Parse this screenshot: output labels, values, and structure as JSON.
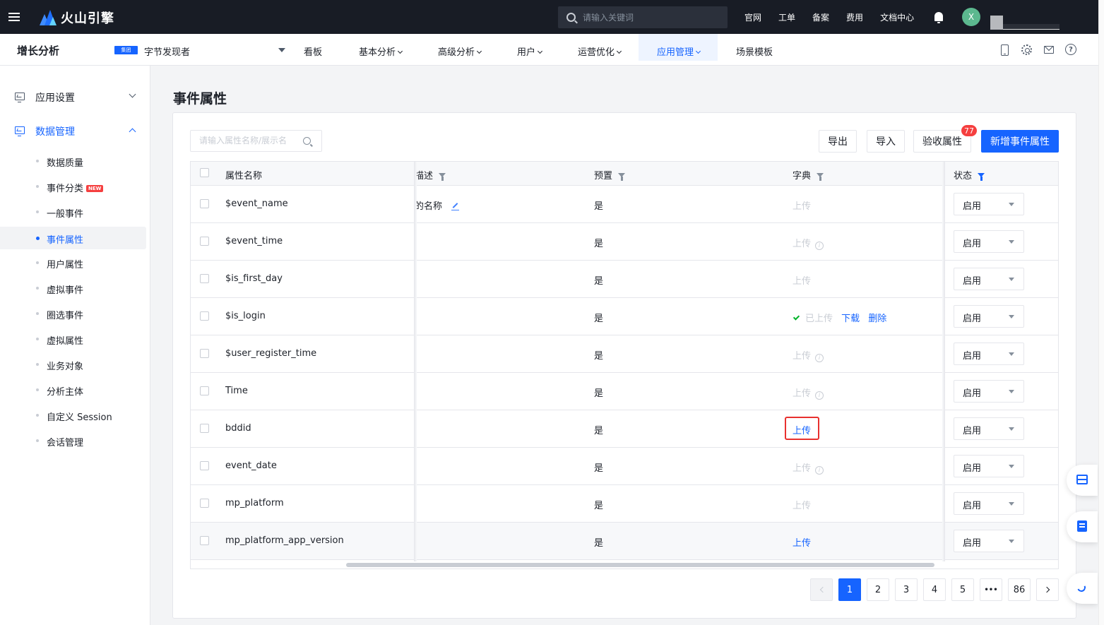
{
  "brand": {
    "name": "火山引擎"
  },
  "topbar": {
    "search_placeholder": "请输入关键词",
    "links": [
      "官网",
      "工单",
      "备案",
      "费用",
      "文档中心"
    ],
    "avatar_initial": "X"
  },
  "subnav": {
    "product": "增长分析",
    "group_tag": "集团",
    "app_name": "字节发现者",
    "items": [
      {
        "label": "看板",
        "chevron": false
      },
      {
        "label": "基本分析",
        "chevron": true
      },
      {
        "label": "高级分析",
        "chevron": true
      },
      {
        "label": "用户",
        "chevron": true
      },
      {
        "label": "运营优化",
        "chevron": true
      },
      {
        "label": "应用管理",
        "chevron": true,
        "active": true
      },
      {
        "label": "场景模板",
        "chevron": false
      }
    ]
  },
  "sidebar": {
    "groups": [
      {
        "label": "应用设置",
        "open": false
      },
      {
        "label": "数据管理",
        "open": true
      }
    ],
    "items": [
      {
        "label": "数据质量"
      },
      {
        "label": "事件分类",
        "badge": "NEW"
      },
      {
        "label": "一般事件"
      },
      {
        "label": "事件属性",
        "active": true
      },
      {
        "label": "用户属性"
      },
      {
        "label": "虚拟事件"
      },
      {
        "label": "圈选事件"
      },
      {
        "label": "虚拟属性"
      },
      {
        "label": "业务对象"
      },
      {
        "label": "分析主体"
      },
      {
        "label": "自定义 Session"
      },
      {
        "label": "会话管理"
      }
    ]
  },
  "main": {
    "title": "事件属性",
    "search_placeholder": "请输入属性名称/展示名",
    "buttons": {
      "export": "导出",
      "import": "导入",
      "verify": "验收属性",
      "verify_count": "77",
      "add": "新增事件属性"
    },
    "columns": {
      "name": "属性名称",
      "desc": "描述",
      "preset": "预置",
      "dict": "字典",
      "status": "状态"
    },
    "rows": [
      {
        "name": "$event_name",
        "desc": "的名称",
        "preset": "是",
        "dict": "上传",
        "dict_state": "muted",
        "info": false,
        "status": "启用"
      },
      {
        "name": "$event_time",
        "desc": "",
        "preset": "是",
        "dict": "上传",
        "dict_state": "muted",
        "info": true,
        "status": "启用"
      },
      {
        "name": "$is_first_day",
        "desc": "",
        "preset": "是",
        "dict": "上传",
        "dict_state": "muted",
        "info": false,
        "status": "启用"
      },
      {
        "name": "$is_login",
        "desc": "",
        "preset": "是",
        "dict": "已上传",
        "dict_state": "uploaded",
        "download": "下载",
        "delete": "删除",
        "info": false,
        "status": "启用"
      },
      {
        "name": "$user_register_time",
        "desc": "",
        "preset": "是",
        "dict": "上传",
        "dict_state": "muted",
        "info": true,
        "status": "启用"
      },
      {
        "name": "Time",
        "desc": "",
        "preset": "是",
        "dict": "上传",
        "dict_state": "muted",
        "info": true,
        "status": "启用"
      },
      {
        "name": "bddid",
        "desc": "",
        "preset": "是",
        "dict": "上传",
        "dict_state": "link",
        "info": false,
        "status": "启用"
      },
      {
        "name": "event_date",
        "desc": "",
        "preset": "是",
        "dict": "上传",
        "dict_state": "muted",
        "info": true,
        "status": "启用"
      },
      {
        "name": "mp_platform",
        "desc": "",
        "preset": "是",
        "dict": "上传",
        "dict_state": "muted",
        "info": false,
        "status": "启用"
      },
      {
        "name": "mp_platform_app_version",
        "desc": "",
        "preset": "是",
        "dict": "上传",
        "dict_state": "link",
        "info": false,
        "status": "启用"
      }
    ],
    "pagination": {
      "pages": [
        "1",
        "2",
        "3",
        "4",
        "5"
      ],
      "ellipsis": "•••",
      "last": "86",
      "current": "1"
    }
  }
}
